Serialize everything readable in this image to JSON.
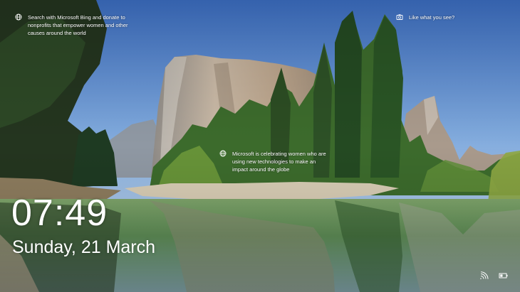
{
  "background": {
    "subject": "El Capitan reflected in the Merced River, Yosemite",
    "colors": {
      "sky_top": "#3f72c6",
      "sky_bottom": "#cfe2f3",
      "rock": "#b9a58f",
      "trees": "#2f5a2a",
      "water": "#5b8f63"
    }
  },
  "spotlight": {
    "search_tip": "Search with Microsoft Bing and donate to nonprofits that empower women and other causes around the world",
    "like_prompt": "Like what you see?",
    "hotspot_tip": "Microsoft is celebrating women who are using new technologies to make an impact around the globe"
  },
  "lock": {
    "time": "07:49",
    "date": "Sunday, 21 March"
  },
  "tray": {
    "network_icon": "wifi-icon",
    "battery_icon": "battery-icon"
  }
}
